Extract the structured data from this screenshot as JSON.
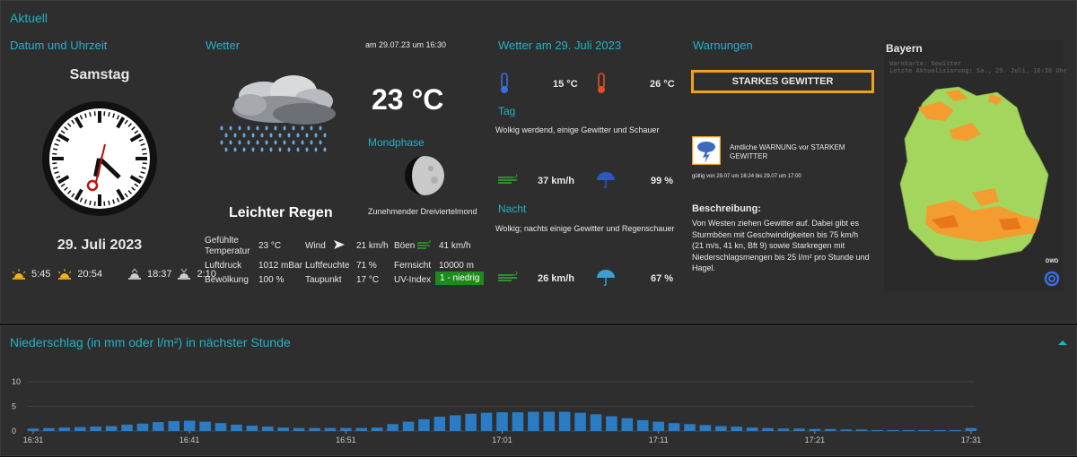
{
  "header": {
    "title": "Aktuell"
  },
  "datetime": {
    "section_title": "Datum und Uhrzeit",
    "weekday": "Samstag",
    "date": "29. Juli 2023",
    "sunrise": "5:45",
    "sunset": "20:54",
    "moonrise": "18:37",
    "moonset": "2:10",
    "clock_time": "16:31"
  },
  "weather": {
    "section_title": "Wetter",
    "timestamp": "am 29.07.23 um 16:30",
    "temperature": "23 °C",
    "condition": "Leichter Regen",
    "moon_title": "Mondphase",
    "moon_phase": "Zunehmender Dreiviertelmond",
    "details": {
      "felt_label": "Gefühlte Temperatur",
      "felt_value": "23 °C",
      "wind_label": "Wind",
      "wind_value": "21 km/h",
      "gust_label": "Böen",
      "gust_value": "41 km/h",
      "pressure_label": "Luftdruck",
      "pressure_value": "1012 mBar",
      "humidity_label": "Luftfeuchte",
      "humidity_value": "71 %",
      "visibility_label": "Fernsicht",
      "visibility_value": "10000 m",
      "clouds_label": "Bewölkung",
      "clouds_value": "100 %",
      "dewpoint_label": "Taupunkt",
      "dewpoint_value": "17 °C",
      "uv_label": "UV-Index",
      "uv_value": "1 - niedrig"
    }
  },
  "forecast": {
    "section_title": "Wetter am 29. Juli 2023",
    "temp_min": "15 °C",
    "temp_max": "26 °C",
    "day_label": "Tag",
    "day_text": "Wolkig werdend, einige Gewitter und Schauer",
    "day_wind": "37 km/h",
    "day_rain": "99 %",
    "night_label": "Nacht",
    "night_text": "Wolkig; nachts einige Gewitter und Regenschauer",
    "night_wind": "26 km/h",
    "night_rain": "67 %"
  },
  "warnings": {
    "section_title": "Warnungen",
    "level": "STARKES GEWITTER",
    "official_text": "Amtliche WARNUNG vor STARKEM GEWITTER",
    "validity": "gültig von 29.07 um 16:24 bis 29.07 um 17:00",
    "desc_title": "Beschreibung:",
    "description": "Von Westen ziehen Gewitter auf. Dabei gibt es Sturmböen mit Geschwindigkeiten bis 75 km/h (21 m/s, 41 kn, Bft 9) sowie Starkregen mit Niederschlagsmengen bis 25 l/m² pro Stunde und Hagel."
  },
  "map": {
    "title": "Bayern",
    "line1": "Warnkarte: Gewitter",
    "line2": "Letzte Aktualisierung: Sa., 29. Juli, 16:36 Uhr",
    "logo": "DWD"
  },
  "precip_panel": {
    "title": "Niederschlag (in mm oder l/m²) in nächster Stunde"
  },
  "chart_data": {
    "type": "bar",
    "title": "Niederschlag (in mm oder l/m²) in nächster Stunde",
    "ylim": [
      0,
      10
    ],
    "yticks": [
      0,
      5,
      10
    ],
    "xticks": [
      "16:31",
      "16:41",
      "16:51",
      "17:01",
      "17:11",
      "17:21",
      "17:31"
    ],
    "color": "#2b7cc4",
    "values": [
      0.5,
      0.6,
      0.7,
      0.8,
      0.9,
      1.0,
      1.3,
      1.5,
      1.8,
      2.0,
      2.1,
      1.9,
      1.6,
      1.3,
      1.1,
      0.9,
      0.7,
      0.6,
      0.6,
      0.6,
      0.6,
      0.6,
      0.7,
      1.4,
      1.9,
      2.4,
      2.9,
      3.2,
      3.5,
      3.7,
      3.8,
      3.8,
      3.9,
      3.9,
      3.9,
      3.7,
      3.4,
      3.0,
      2.6,
      2.2,
      1.9,
      1.6,
      1.4,
      1.2,
      1.0,
      0.9,
      0.7,
      0.6,
      0.5,
      0.5,
      0.4,
      0.4,
      0.3,
      0.3,
      0.2,
      0.2,
      0.2,
      0.2,
      0.2,
      0.2,
      0.6
    ]
  }
}
